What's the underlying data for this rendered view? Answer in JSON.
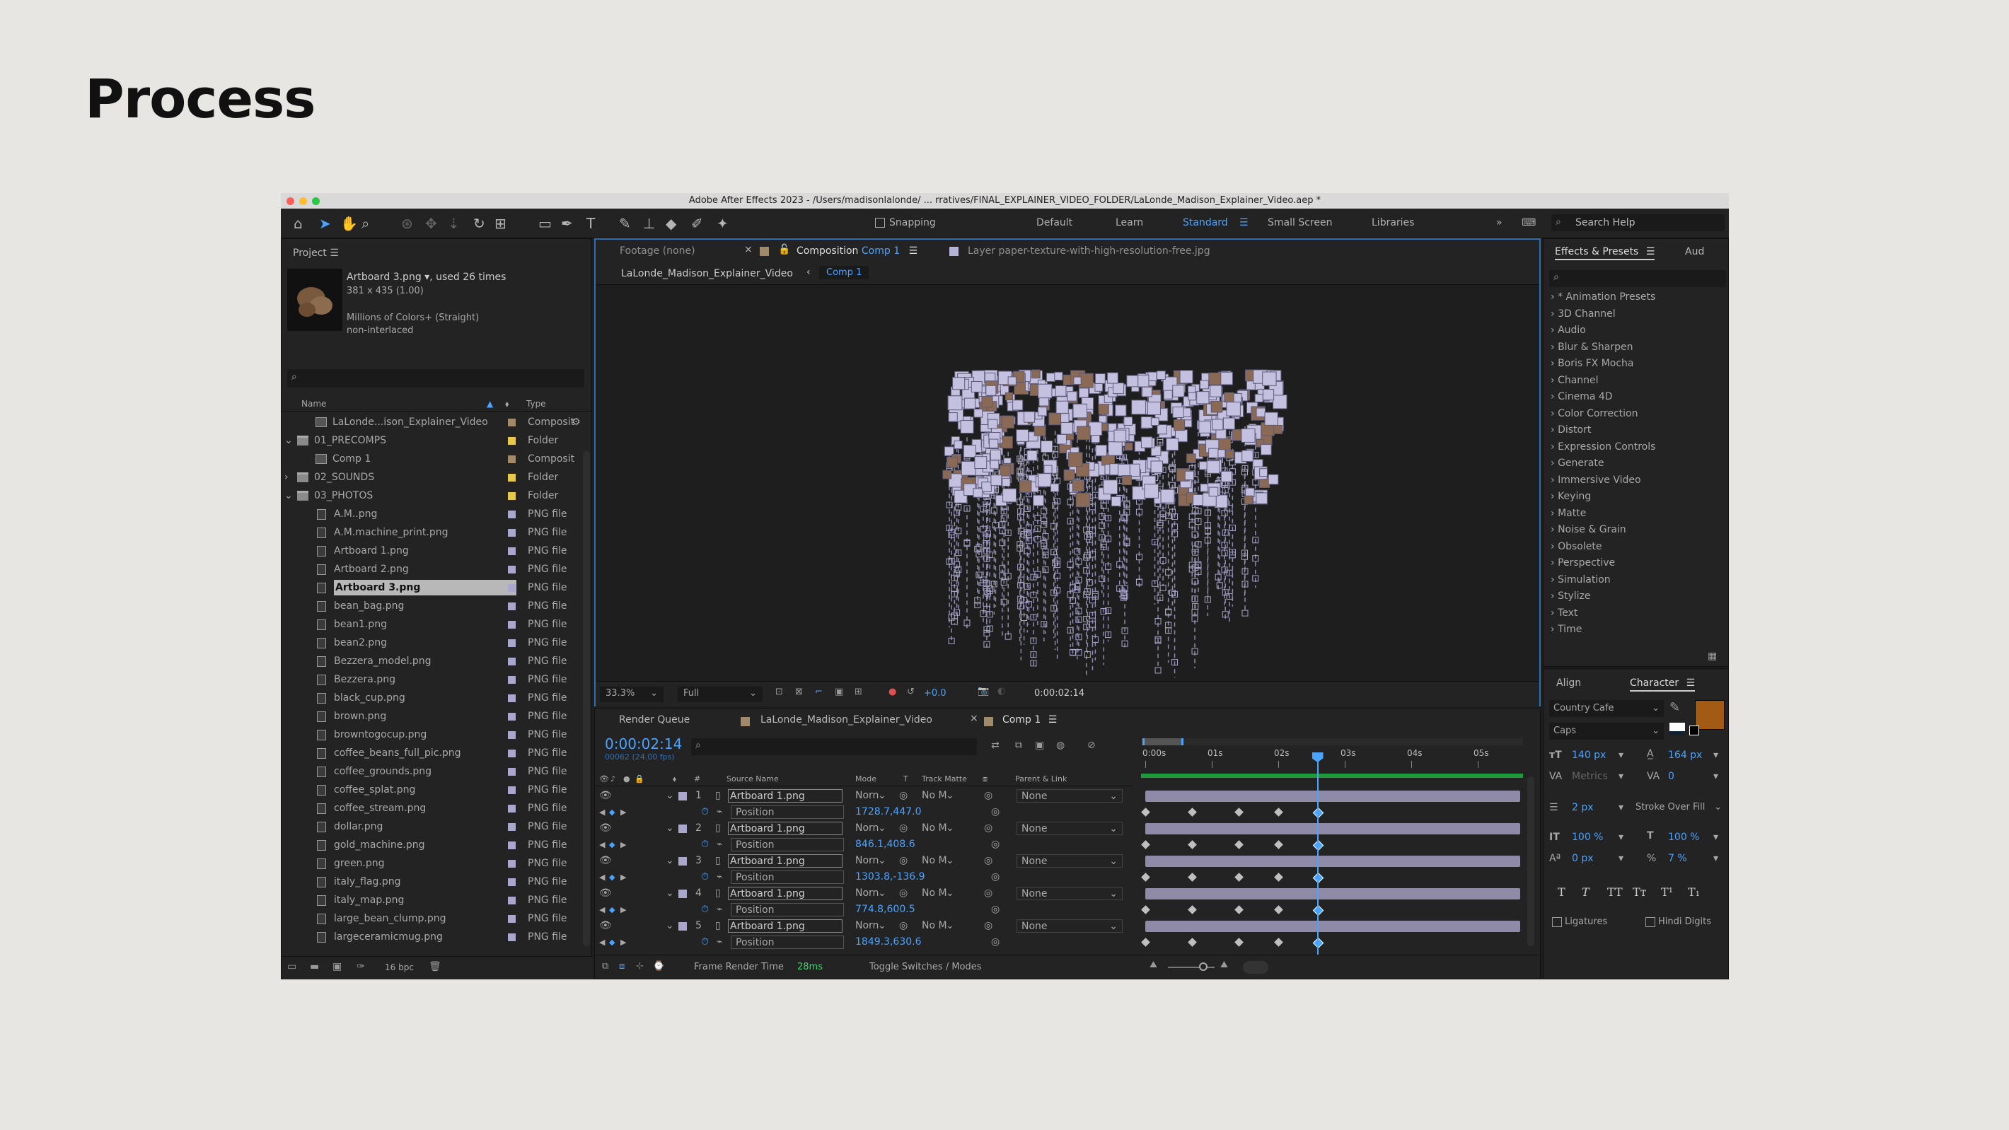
{
  "slide": {
    "title": "Process"
  },
  "app": {
    "window_title": "Adobe After Effects 2023 - /Users/madisonlalonde/ ... rratives/FINAL_EXPLAINER_VIDEO_FOLDER/LaLonde_Madison_Explainer_Video.aep *",
    "toolbar": {
      "snapping_label": "Snapping",
      "workspaces": [
        "Default",
        "Learn",
        "Standard",
        "Small Screen",
        "Libraries"
      ],
      "active_workspace": "Standard",
      "search_placeholder": "Search Help"
    },
    "project": {
      "tab_label": "Project",
      "preview": {
        "name": "Artboard 3.png ▾",
        "used": ", used 26 times",
        "dims": "381 x 435 (1.00)",
        "colors": "Millions of Colors+ (Straight)",
        "interlace": "non-interlaced"
      },
      "search_placeholder": "",
      "columns": {
        "name": "Name",
        "type": "Type"
      },
      "items": [
        {
          "name": "LaLonde...ison_Explainer_Video",
          "type": "Composit",
          "kind": "comp",
          "indent": 1,
          "swatch": "#a08a6a"
        },
        {
          "name": "01_PRECOMPS",
          "type": "Folder",
          "kind": "folder",
          "indent": 0,
          "swatch": "#e6c94a",
          "open": true
        },
        {
          "name": "Comp 1",
          "type": "Composit",
          "kind": "comp",
          "indent": 1,
          "swatch": "#a08a6a"
        },
        {
          "name": "02_SOUNDS",
          "type": "Folder",
          "kind": "folder",
          "indent": 0,
          "swatch": "#e6c94a",
          "open": false
        },
        {
          "name": "03_PHOTOS",
          "type": "Folder",
          "kind": "folder",
          "indent": 0,
          "swatch": "#e6c94a",
          "open": true
        },
        {
          "name": "A.M..png",
          "type": "PNG file",
          "kind": "file",
          "indent": 2,
          "swatch": "#a9a7cc"
        },
        {
          "name": "A.M.machine_print.png",
          "type": "PNG file",
          "kind": "file",
          "indent": 2,
          "swatch": "#a9a7cc"
        },
        {
          "name": "Artboard 1.png",
          "type": "PNG file",
          "kind": "file",
          "indent": 2,
          "swatch": "#a9a7cc"
        },
        {
          "name": "Artboard 2.png",
          "type": "PNG file",
          "kind": "file",
          "indent": 2,
          "swatch": "#a9a7cc"
        },
        {
          "name": "Artboard 3.png",
          "type": "PNG file",
          "kind": "file",
          "indent": 2,
          "swatch": "#a9a7cc",
          "selected": true
        },
        {
          "name": "bean_bag.png",
          "type": "PNG file",
          "kind": "file",
          "indent": 2,
          "swatch": "#a9a7cc"
        },
        {
          "name": "bean1.png",
          "type": "PNG file",
          "kind": "file",
          "indent": 2,
          "swatch": "#a9a7cc"
        },
        {
          "name": "bean2.png",
          "type": "PNG file",
          "kind": "file",
          "indent": 2,
          "swatch": "#a9a7cc"
        },
        {
          "name": "Bezzera_model.png",
          "type": "PNG file",
          "kind": "file",
          "indent": 2,
          "swatch": "#a9a7cc"
        },
        {
          "name": "Bezzera.png",
          "type": "PNG file",
          "kind": "file",
          "indent": 2,
          "swatch": "#a9a7cc"
        },
        {
          "name": "black_cup.png",
          "type": "PNG file",
          "kind": "file",
          "indent": 2,
          "swatch": "#a9a7cc"
        },
        {
          "name": "brown.png",
          "type": "PNG file",
          "kind": "file",
          "indent": 2,
          "swatch": "#a9a7cc"
        },
        {
          "name": "browntogocup.png",
          "type": "PNG file",
          "kind": "file",
          "indent": 2,
          "swatch": "#a9a7cc"
        },
        {
          "name": "coffee_beans_full_pic.png",
          "type": "PNG file",
          "kind": "file",
          "indent": 2,
          "swatch": "#a9a7cc"
        },
        {
          "name": "coffee_grounds.png",
          "type": "PNG file",
          "kind": "file",
          "indent": 2,
          "swatch": "#a9a7cc"
        },
        {
          "name": "coffee_splat.png",
          "type": "PNG file",
          "kind": "file",
          "indent": 2,
          "swatch": "#a9a7cc"
        },
        {
          "name": "coffee_stream.png",
          "type": "PNG file",
          "kind": "file",
          "indent": 2,
          "swatch": "#a9a7cc"
        },
        {
          "name": "dollar.png",
          "type": "PNG file",
          "kind": "file",
          "indent": 2,
          "swatch": "#a9a7cc"
        },
        {
          "name": "gold_machine.png",
          "type": "PNG file",
          "kind": "file",
          "indent": 2,
          "swatch": "#a9a7cc"
        },
        {
          "name": "green.png",
          "type": "PNG file",
          "kind": "file",
          "indent": 2,
          "swatch": "#a9a7cc"
        },
        {
          "name": "italy_flag.png",
          "type": "PNG file",
          "kind": "file",
          "indent": 2,
          "swatch": "#a9a7cc"
        },
        {
          "name": "italy_map.png",
          "type": "PNG file",
          "kind": "file",
          "indent": 2,
          "swatch": "#a9a7cc"
        },
        {
          "name": "large_bean_clump.png",
          "type": "PNG file",
          "kind": "file",
          "indent": 2,
          "swatch": "#a9a7cc"
        },
        {
          "name": "largeceramicmug.png",
          "type": "PNG file",
          "kind": "file",
          "indent": 2,
          "swatch": "#a9a7cc"
        }
      ],
      "bpc": "16 bpc"
    },
    "viewer": {
      "tab_footage": "Footage (none)",
      "tab_comp_prefix": "Composition",
      "tab_comp_name": "Comp 1",
      "tab_layer": "Layer paper-texture-with-high-resolution-free.jpg",
      "breadcrumb": [
        "LaLonde_Madison_Explainer_Video",
        "Comp 1"
      ],
      "zoom": "33.3%",
      "resolution": "Full",
      "exposure": "+0.0",
      "timecode": "0:00:02:14"
    },
    "timeline": {
      "tabs": [
        "Render Queue",
        "LaLonde_Madison_Explainer_Video",
        "Comp 1"
      ],
      "timecode": "0:00:02:14",
      "frame_info": "00062 (24.00 fps)",
      "columns": [
        "Source Name",
        "Mode",
        "T",
        "Track Matte",
        "Parent & Link"
      ],
      "ruler": [
        "0:00s",
        "01s",
        "02s",
        "03s",
        "04s",
        "05s"
      ],
      "playhead_seconds": 2.58,
      "layers": [
        {
          "num": "1",
          "name": "Artboard 1.png",
          "mode": "Norn",
          "matte": "No M",
          "parent": "None",
          "position": "1728.7,447.0"
        },
        {
          "num": "2",
          "name": "Artboard 1.png",
          "mode": "Norn",
          "matte": "No M",
          "parent": "None",
          "position": "846.1,408.6"
        },
        {
          "num": "3",
          "name": "Artboard 1.png",
          "mode": "Norn",
          "matte": "No M",
          "parent": "None",
          "position": "1303.8,-136.9"
        },
        {
          "num": "4",
          "name": "Artboard 1.png",
          "mode": "Norn",
          "matte": "No M",
          "parent": "None",
          "position": "774.8,600.5"
        },
        {
          "num": "5",
          "name": "Artboard 1.png",
          "mode": "Norn",
          "matte": "No M",
          "parent": "None",
          "position": "1849.3,630.6"
        }
      ],
      "property_label": "Position",
      "keyframe_seconds": [
        0.0,
        0.7,
        1.4,
        2.0,
        2.58
      ],
      "footer_render_label": "Frame Render Time",
      "footer_render_value": "28ms",
      "footer_toggle": "Toggle Switches / Modes"
    },
    "effects": {
      "tab_label": "Effects & Presets",
      "tab_aud": "Aud",
      "items": [
        "* Animation Presets",
        "3D Channel",
        "Audio",
        "Blur & Sharpen",
        "Boris FX Mocha",
        "Channel",
        "Cinema 4D",
        "Color Correction",
        "Distort",
        "Expression Controls",
        "Generate",
        "Immersive Video",
        "Keying",
        "Matte",
        "Noise & Grain",
        "Obsolete",
        "Perspective",
        "Simulation",
        "Stylize",
        "Text",
        "Time"
      ]
    },
    "character": {
      "tab_align": "Align",
      "tab_character": "Character",
      "font": "Country Cafe",
      "style": "Caps",
      "size": "140 px",
      "leading": "164 px",
      "kerning": "Metrics",
      "tracking": "0",
      "stroke": "2 px",
      "stroke_mode": "Stroke Over Fill",
      "vscale": "100 %",
      "hscale": "100 %",
      "baseline": "0 px",
      "tsume": "7 %",
      "fill_color": "#a35a14",
      "style_buttons": [
        "T",
        "T",
        "TT",
        "Tт",
        "T¹",
        "T₁"
      ],
      "ligatures": "Ligatures",
      "hindi": "Hindi Digits"
    }
  }
}
